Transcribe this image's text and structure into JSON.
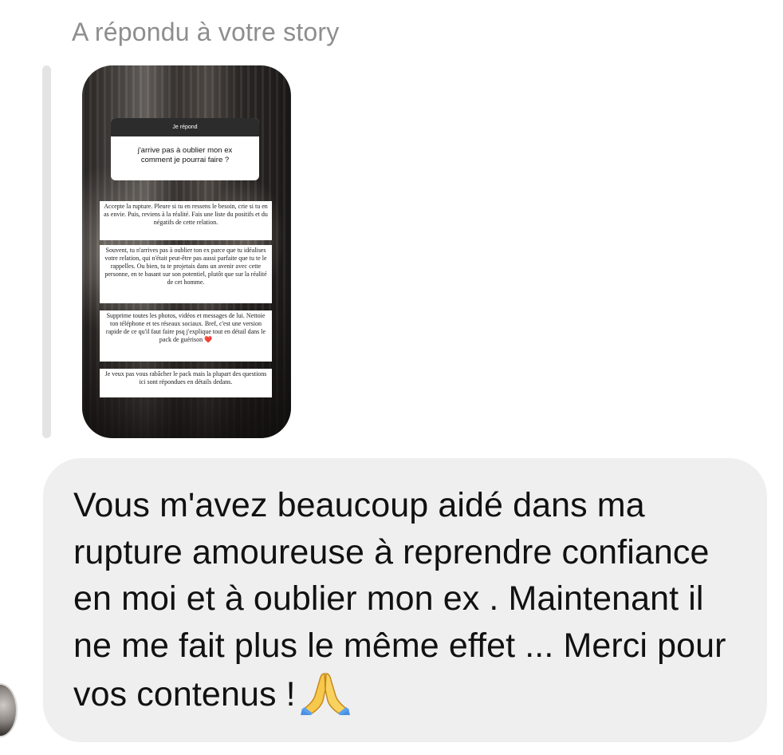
{
  "header": {
    "reply_label": "A répondu à votre story"
  },
  "story": {
    "question_header": "Je répond",
    "question_text": "j'arrive pas à oublier mon ex comment je pourrai faire ?",
    "paragraphs": [
      "Accepte la rupture. Pleure si tu en ressens le besoin, crie si tu en as envie. Puis, reviens à la réalité. Fais une liste du positifs et du négatifs de cette relation.",
      "Souvent, tu n'arrives pas à oublier ton ex parce que tu idéalises votre relation, qui n'était peut-être pas aussi parfaite que tu te le rappelles. Ou bien, tu te projetais dans un avenir avec cette personne, en te basant sur son potentiel, plutôt que sur la réalité de cet homme.",
      "Supprime toutes les photos, vidéos et messages de lui. Nettoie ton téléphone et tes réseaux sociaux. Bref, c'est une version rapide de ce qu'il faut faire psq j'explique tout en détail dans le pack de guérison",
      "Je veux pas vous rabâcher le pack mais la plupart des questions ici sont répondues en détails dedans."
    ],
    "heart_emoji": "❤️"
  },
  "message": {
    "text": "Vous m'avez beaucoup aidé dans ma rupture amoureuse à reprendre confiance en moi et à oublier mon ex . Maintenant il ne me fait plus le même effet ... Merci pour vos contenus !",
    "emoji_icon": "folded-hands-icon"
  },
  "colors": {
    "bubble_bg": "#efefef",
    "header_text": "#8e8e8e",
    "quote_bar": "#e4e4e6"
  }
}
